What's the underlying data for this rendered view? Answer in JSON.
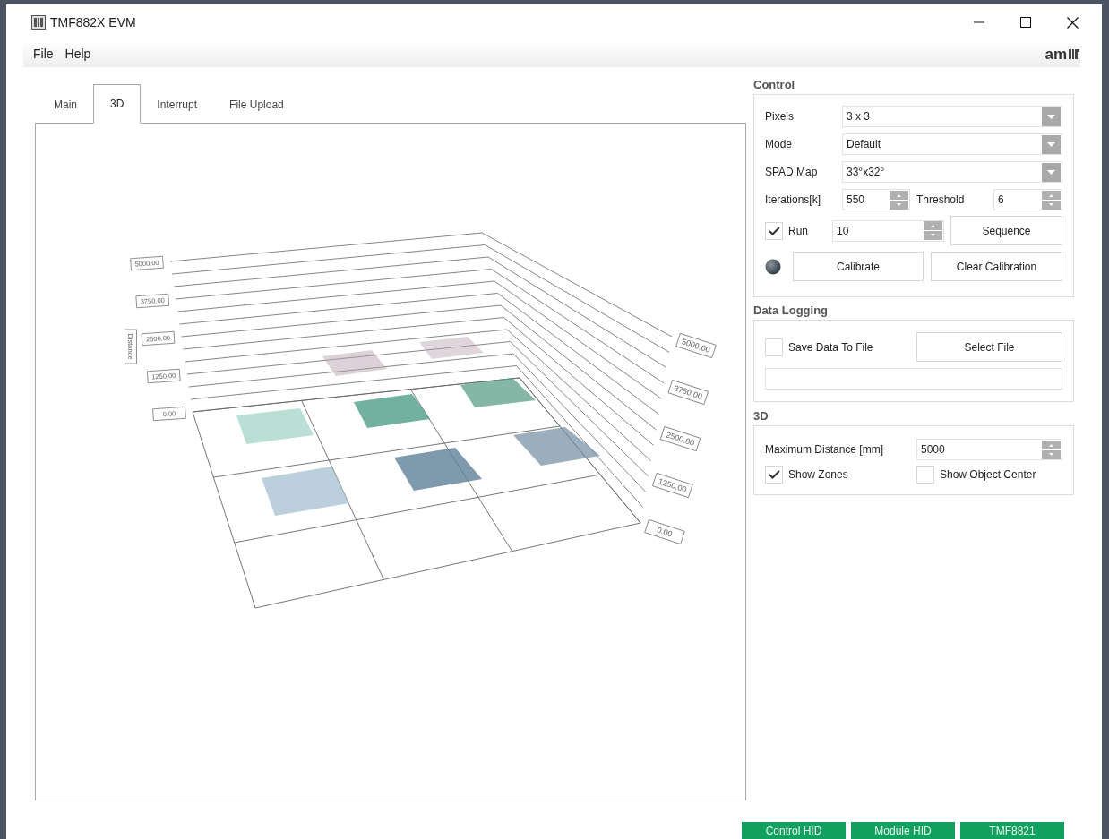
{
  "window": {
    "title": "TMF882X EVM"
  },
  "menu": [
    {
      "label": "File"
    },
    {
      "label": "Help"
    }
  ],
  "logo": {
    "text": "am"
  },
  "tabs": [
    {
      "label": "Main",
      "selected": false
    },
    {
      "label": "3D",
      "selected": true
    },
    {
      "label": "Interrupt",
      "selected": false
    },
    {
      "label": "File Upload",
      "selected": false
    }
  ],
  "view_3d": {
    "axis_title": "Distance",
    "left_ticks": [
      "5000.00",
      "3750.00",
      "2500.00",
      "1250.00",
      "0.00"
    ],
    "right_ticks": [
      "5000.00",
      "3750.00",
      "2500.00",
      "1250.00",
      "0.00"
    ]
  },
  "control": {
    "title": "Control",
    "pixels": {
      "label": "Pixels",
      "value": "3 x 3"
    },
    "mode": {
      "label": "Mode",
      "value": "Default"
    },
    "spad_map": {
      "label": "SPAD Map",
      "value": "33°x32°"
    },
    "iterations": {
      "label": "Iterations[k]",
      "value": "550"
    },
    "threshold": {
      "label": "Threshold",
      "value": "6"
    },
    "run": {
      "label": "Run",
      "checked": true,
      "value": "10"
    },
    "sequence_button": "Sequence",
    "calibrate_button": "Calibrate",
    "clear_calibration_button": "Clear Calibration"
  },
  "data_logging": {
    "title": "Data Logging",
    "save_to_file": {
      "label": "Save Data To File",
      "checked": false
    },
    "select_file_button": "Select File"
  },
  "settings_3d": {
    "title": "3D",
    "max_distance": {
      "label": "Maximum Distance [mm]",
      "value": "5000"
    },
    "show_zones": {
      "label": "Show Zones",
      "checked": true
    },
    "show_object_center": {
      "label": "Show Object Center",
      "checked": false
    }
  },
  "status_bar": [
    {
      "label": "Control HID"
    },
    {
      "label": "Module HID"
    },
    {
      "label": "TMF8821"
    }
  ]
}
